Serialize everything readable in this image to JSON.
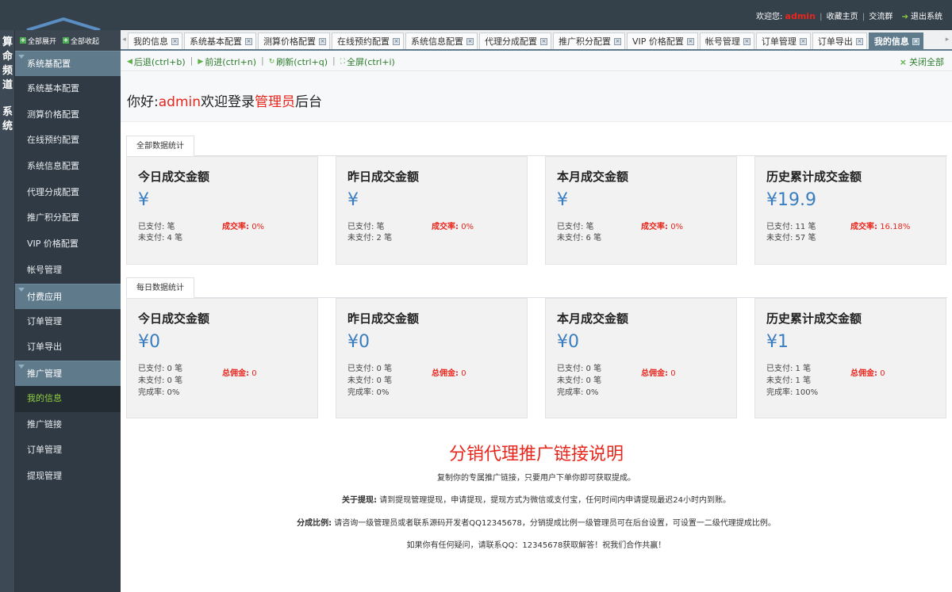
{
  "header": {
    "welcome": "欢迎您:",
    "username": "admin",
    "links": [
      "|",
      "收藏主页",
      "|",
      "交流群"
    ],
    "bookmark": "收藏主页",
    "group": "交流群",
    "logout": "退出系统"
  },
  "channel": {
    "label1": "算命频道",
    "label2": "系统"
  },
  "sidebar": {
    "expand_all": "全部展开",
    "collapse_all": "全部收起",
    "groups": [
      {
        "label": "系统基配置"
      },
      {
        "label": "付费应用"
      },
      {
        "label": "推广管理"
      }
    ],
    "items_g1": [
      "系统基本配置",
      "测算价格配置",
      "在线预约配置",
      "系统信息配置",
      "代理分成配置",
      "推广积分配置",
      "VIP 价格配置",
      "帐号管理"
    ],
    "items_g2": [
      "订单管理",
      "订单导出"
    ],
    "items_g3": [
      "我的信息",
      "推广链接",
      "订单管理",
      "提现管理"
    ]
  },
  "tabs": [
    "我的信息",
    "系统基本配置",
    "测算价格配置",
    "在线预约配置",
    "系统信息配置",
    "代理分成配置",
    "推广积分配置",
    "VIP 价格配置",
    "帐号管理",
    "订单管理",
    "订单导出",
    "我的信息"
  ],
  "toolbar": {
    "back": "后退(ctrl+b)",
    "forward": "前进(ctrl+n)",
    "refresh": "刷新(ctrl+q)",
    "fullscreen": "全屏(ctrl+i)",
    "close_all": "关闭全部"
  },
  "welcome": {
    "prefix": "你好:",
    "user": "admin",
    "mid": "欢迎登录",
    "role": "管理员",
    "suffix": "后台"
  },
  "total_stats": {
    "tab": "全部数据统计",
    "cards": [
      {
        "title": "今日成交金额",
        "amount": "¥",
        "paid": "已支付: 笔",
        "unpaid": "未支付: 4 笔",
        "rate_label": "成交率:",
        "rate": "0%"
      },
      {
        "title": "昨日成交金额",
        "amount": "¥",
        "paid": "已支付: 笔",
        "unpaid": "未支付: 2 笔",
        "rate_label": "成交率:",
        "rate": "0%"
      },
      {
        "title": "本月成交金额",
        "amount": "¥",
        "paid": "已支付: 笔",
        "unpaid": "未支付: 6 笔",
        "rate_label": "成交率:",
        "rate": "0%"
      },
      {
        "title": "历史累计成交金额",
        "amount": "¥19.9",
        "paid": "已支付: 11 笔",
        "unpaid": "未支付: 57 笔",
        "rate_label": "成交率:",
        "rate": "16.18%"
      }
    ]
  },
  "daily_stats": {
    "tab": "每日数据统计",
    "cards": [
      {
        "title": "今日成交金额",
        "amount": "¥0",
        "paid": "已支付: 0 笔",
        "unpaid": "未支付: 0 笔",
        "done": "完成率: 0%",
        "comm_label": "总佣金:",
        "comm": "0"
      },
      {
        "title": "昨日成交金额",
        "amount": "¥0",
        "paid": "已支付: 0 笔",
        "unpaid": "未支付: 0 笔",
        "done": "完成率: 0%",
        "comm_label": "总佣金:",
        "comm": "0"
      },
      {
        "title": "本月成交金额",
        "amount": "¥0",
        "paid": "已支付: 0 笔",
        "unpaid": "未支付: 0 笔",
        "done": "完成率: 0%",
        "comm_label": "总佣金:",
        "comm": "0"
      },
      {
        "title": "历史累计成交金额",
        "amount": "¥1",
        "paid": "已支付: 1 笔",
        "unpaid": "未支付: 1 笔",
        "done": "完成率: 100%",
        "comm_label": "总佣金:",
        "comm": "0"
      }
    ]
  },
  "description": {
    "title": "分销代理推广链接说明",
    "line1": "复制你的专属推广链接，只要用户下单你即可获取提成。",
    "line2_label": "关于提现:",
    "line2": "请到提现管理提现，申请提现，提现方式为微信或支付宝，任何时间内申请提现最迟24小时内到账。",
    "line3_label": "分成比例:",
    "line3": "请咨询一级管理员或者联系源码开发者QQ12345678，分销提成比例一级管理员可在后台设置，可设置一二级代理提成比例。",
    "line4": "如果你有任何疑问，请联系QQ：12345678获取解答！祝我们合作共赢！"
  },
  "colors": {
    "topbar": "#34404a",
    "sidebar": "#303a44",
    "group": "#5f7a8b",
    "accent_red": "#e8261c",
    "amount_blue": "#3a7ebf",
    "active_green": "#8fd13f"
  }
}
